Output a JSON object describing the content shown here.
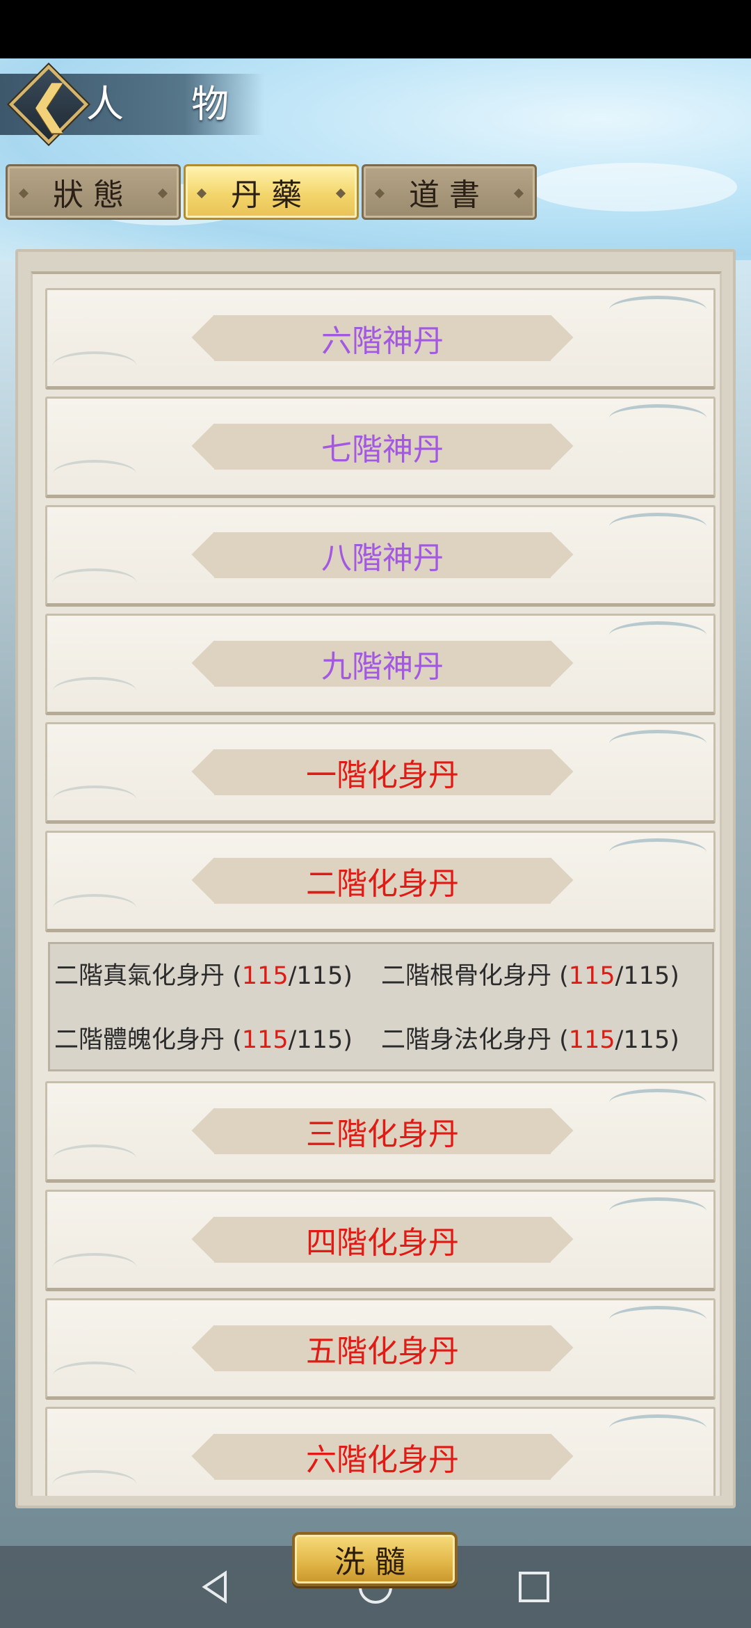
{
  "header": {
    "title": "人 物",
    "back_icon": "chevron-left-icon"
  },
  "tabs": [
    {
      "label": "狀態",
      "active": false
    },
    {
      "label": "丹藥",
      "active": true
    },
    {
      "label": "道書",
      "active": false
    }
  ],
  "items": [
    {
      "label": "六階神丹",
      "color": "#a259e0"
    },
    {
      "label": "七階神丹",
      "color": "#a259e0"
    },
    {
      "label": "八階神丹",
      "color": "#a259e0"
    },
    {
      "label": "九階神丹",
      "color": "#a259e0"
    },
    {
      "label": "一階化身丹",
      "color": "#e01a14"
    },
    {
      "label": "二階化身丹",
      "color": "#e01a14"
    },
    {
      "label": "三階化身丹",
      "color": "#e01a14"
    },
    {
      "label": "四階化身丹",
      "color": "#e01a14"
    },
    {
      "label": "五階化身丹",
      "color": "#e01a14"
    },
    {
      "label": "六階化身丹",
      "color": "#e01a14"
    }
  ],
  "expanded_detail": {
    "entries": [
      {
        "name": "二階真氣化身丹",
        "current": "115",
        "max": "115"
      },
      {
        "name": "二階根骨化身丹",
        "current": "115",
        "max": "115"
      },
      {
        "name": "二階體魄化身丹",
        "current": "115",
        "max": "115"
      },
      {
        "name": "二階身法化身丹",
        "current": "115",
        "max": "115"
      }
    ]
  },
  "footer": {
    "button_label": "洗髓"
  },
  "system_nav": {
    "back_icon": "triangle-back-icon",
    "home_icon": "circle-home-icon",
    "recent_icon": "square-recent-icon"
  },
  "colors": {
    "purple_tier": "#a259e0",
    "red_tier": "#e01a14",
    "active_tab": "#f3d56b"
  }
}
